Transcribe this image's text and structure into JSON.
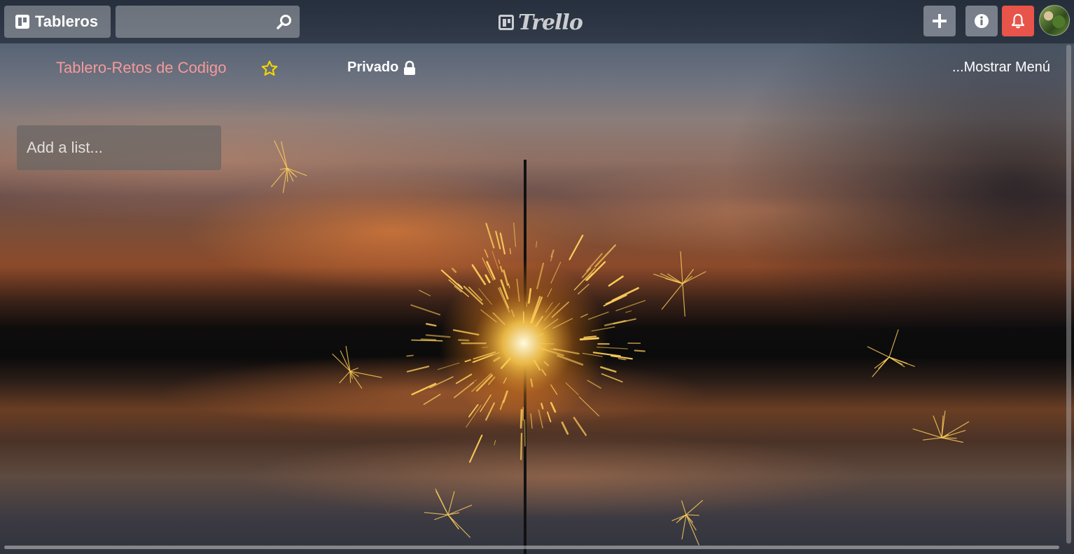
{
  "header": {
    "boards_label": "Tableros",
    "search": {
      "value": "",
      "placeholder": ""
    },
    "logo_text": "Trello",
    "icons": {
      "boards": "boards-icon",
      "search": "search-icon",
      "add": "plus-icon",
      "info": "info-icon",
      "notifications": "bell-icon"
    },
    "colors": {
      "notify_button": "#e8544a"
    }
  },
  "board": {
    "title": "Tablero-Retos de Codigo",
    "title_color": "#f49a9a",
    "star_icon": "star-icon",
    "star_color": "#f2d600",
    "privacy_label": "Privado",
    "privacy_icon": "lock-icon",
    "menu_label": "...Mostrar Menú"
  },
  "lists": {
    "add_list_placeholder": "Add a list..."
  },
  "background": {
    "description_icon": "sparkler-sunset-photo"
  }
}
